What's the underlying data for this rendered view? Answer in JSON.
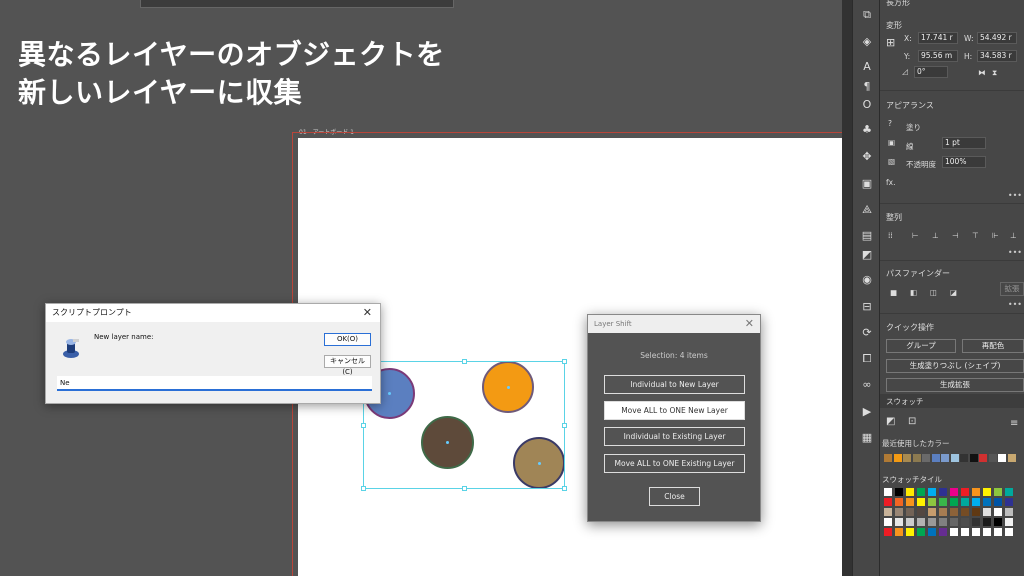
{
  "headline": {
    "line1": "異なるレイヤーのオブジェクトを",
    "line2": "新しいレイヤーに収集"
  },
  "artboard": {
    "label": "01 - アートボード 1"
  },
  "objects": [
    {
      "color": "#5b7fc0",
      "stroke": "#7a3a78"
    },
    {
      "color": "#f39a13",
      "stroke": "#6f5a7a"
    },
    {
      "color": "#5e4a3a",
      "stroke": "#3f6a48"
    },
    {
      "color": "#a08556",
      "stroke": "#3a3a66"
    }
  ],
  "script_prompt": {
    "title": "スクリプトプロンプト",
    "message": "New layer name:",
    "ok_label": "OK(O)",
    "cancel_label": "キャンセル(C)",
    "input_value": "Ne"
  },
  "layer_shift": {
    "title": "Layer Shift",
    "selection": "Selection: 4 items",
    "buttons": [
      "Individual to New Layer",
      "Move ALL to ONE New Layer",
      "Individual to Existing Layer",
      "Move ALL to ONE Existing Layer"
    ],
    "close_label": "Close"
  },
  "properties": {
    "section_title": "長方形",
    "transform_title": "変形",
    "x_label": "X:",
    "x_value": "17.741 r",
    "w_label": "W:",
    "w_value": "54.492 r",
    "y_label": "Y:",
    "y_value": "95.56 m",
    "h_label": "H:",
    "h_value": "34.583 r",
    "angle_value": "0°",
    "appearance_title": "アピアランス",
    "fill_label": "塗り",
    "stroke_label": "線",
    "stroke_weight": "1 pt",
    "opacity_label": "不透明度",
    "opacity_value": "100%",
    "fx_label": "fx.",
    "align_title": "整列",
    "pathfinder_title": "パスファインダー",
    "pathfinder_apply": "拡張",
    "quick_actions_title": "クイック操作",
    "group_label": "グループ",
    "recolor_label": "再配色",
    "generative_fill_label": "生成塗りつぶし (シェイプ)",
    "generative_expand_label": "生成拡張"
  },
  "swatches": {
    "tab_label": "スウォッチ",
    "recent_title": "最近使用したカラー",
    "recent_colors": [
      "#b07a35",
      "#f39a13",
      "#a88a50",
      "#8c7a50",
      "#6a6a6a",
      "#5b7fc0",
      "#7a9acc",
      "#9ec4e0",
      "#333333",
      "#111111",
      "#d03030",
      "#555555",
      "#ffffff",
      "#c8a870"
    ],
    "tile_title": "スウォッチタイル",
    "row1": [
      "#ffffff",
      "#000000",
      "#ffea00",
      "#00a651",
      "#00aeef",
      "#2e3192",
      "#ec008c",
      "#ed1c24",
      "#f7941d",
      "#fff200",
      "#8dc63f",
      "#00a99d"
    ],
    "row2": [
      "#ed1c24",
      "#f26522",
      "#f7941d",
      "#fff200",
      "#8dc63f",
      "#39b54a",
      "#00a651",
      "#00a99d",
      "#00aeef",
      "#0072bc",
      "#0054a6",
      "#2e3192"
    ],
    "row3": [
      "#c7b299",
      "#998675",
      "#736357",
      "#534741",
      "#c69c6d",
      "#a67c52",
      "#8c6239",
      "#754c24",
      "#603913",
      "#e0e0e0",
      "#ffffff",
      "#bdbdbd"
    ],
    "row4": [
      "#ffffff",
      "#e6e6e6",
      "#cccccc",
      "#b3b3b3",
      "#999999",
      "#808080",
      "#666666",
      "#4d4d4d",
      "#333333",
      "#1a1a1a",
      "#000000",
      "#f2f2f2"
    ],
    "row5": [
      "#ed1c24",
      "#f7941d",
      "#fff200",
      "#00a651",
      "#0072bc",
      "#662d91",
      "#ffffff",
      "#ffffff",
      "#ffffff",
      "#ffffff",
      "#ffffff",
      "#ffffff"
    ]
  }
}
